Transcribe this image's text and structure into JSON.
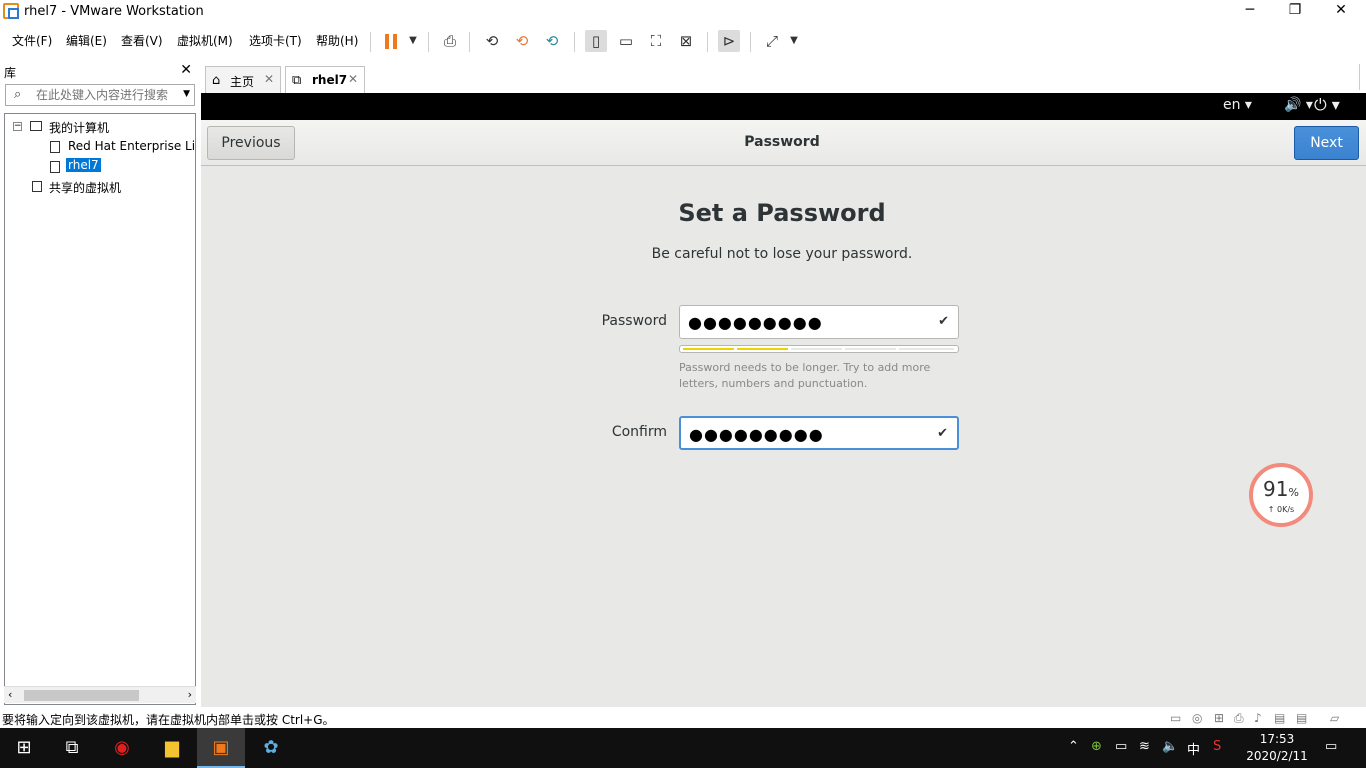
{
  "window": {
    "title": "rhel7 - VMware Workstation",
    "minimize": "─",
    "maximize": "❐",
    "close": "✕"
  },
  "menu": [
    "文件(F)",
    "编辑(E)",
    "查看(V)",
    "虚拟机(M)",
    "选项卡(T)",
    "帮助(H)"
  ],
  "library": {
    "title": "库",
    "close": "✕",
    "search_placeholder": "在此处键入内容进行搜索",
    "tree": {
      "my_computer": "我的计算机",
      "vm1": "Red Hat Enterprise Linux",
      "vm2": "rhel7",
      "shared": "共享的虚拟机"
    }
  },
  "tabs": [
    {
      "label": "主页",
      "icon": "home-icon"
    },
    {
      "label": "rhel7",
      "icon": "vm-icon"
    }
  ],
  "vm": {
    "topbar": {
      "lang": "en ▾",
      "volume": "🔊 ▾",
      "power": "⏻ ▾"
    },
    "header": {
      "prev": "Previous",
      "title": "Password",
      "next": "Next"
    },
    "page_title": "Set a Password",
    "page_subtitle": "Be careful not to lose your password.",
    "password_label": "Password",
    "password_value": "●●●●●●●●●",
    "confirm_label": "Confirm",
    "confirm_value": "●●●●●●●●●",
    "strength_segments_filled": 2,
    "strength_segments_total": 5,
    "hint": "Password needs to be longer. Try to add more letters, numbers and punctuation."
  },
  "net_widget": {
    "percent": "91",
    "unit": "%",
    "speed": "0K/s"
  },
  "status": {
    "message": "要将输入定向到该虚拟机，请在虚拟机内部单击或按 Ctrl+G。"
  },
  "clock": {
    "time": "17:53",
    "date": "2020/2/11"
  },
  "tray": {
    "ime": "中"
  },
  "colors": {
    "accent": "#4a90d9",
    "pause": "#f07a1b",
    "strength": "#edd400"
  }
}
